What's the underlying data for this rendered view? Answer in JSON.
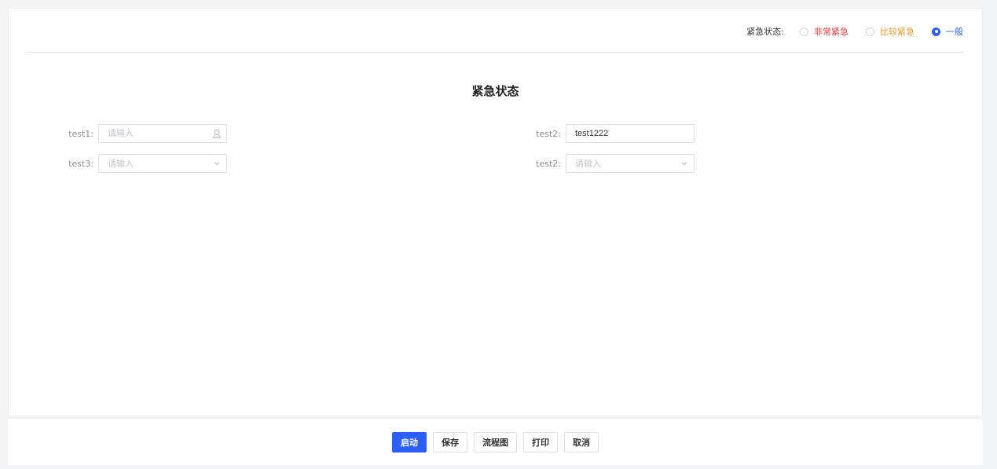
{
  "urgency": {
    "label": "紧急状态:",
    "options": [
      {
        "label": "非常紧急",
        "color": "#f0373b",
        "checked": false
      },
      {
        "label": "比较紧急",
        "color": "#f59a23",
        "checked": false
      },
      {
        "label": "一般",
        "color": "#2c5ff5",
        "checked": true
      }
    ]
  },
  "page_title": "紧急状态",
  "form": {
    "test1": {
      "label": "test1:",
      "placeholder": "请输入",
      "value": "",
      "icon": "user-icon"
    },
    "test2_input": {
      "label": "test2:",
      "placeholder": "请输入",
      "value": "test1222"
    },
    "test3": {
      "label": "test3:",
      "placeholder": "请输入",
      "icon": "chevron-down-icon"
    },
    "test2_select": {
      "label": "test2:",
      "placeholder": "请输入",
      "icon": "chevron-down-icon"
    }
  },
  "footer": {
    "start_label": "启动",
    "save_label": "保存",
    "flowchart_label": "流程图",
    "print_label": "打印",
    "cancel_label": "取消"
  },
  "colors": {
    "primary": "#2c5ff5",
    "danger": "#f0373b",
    "warning": "#f59a23"
  }
}
